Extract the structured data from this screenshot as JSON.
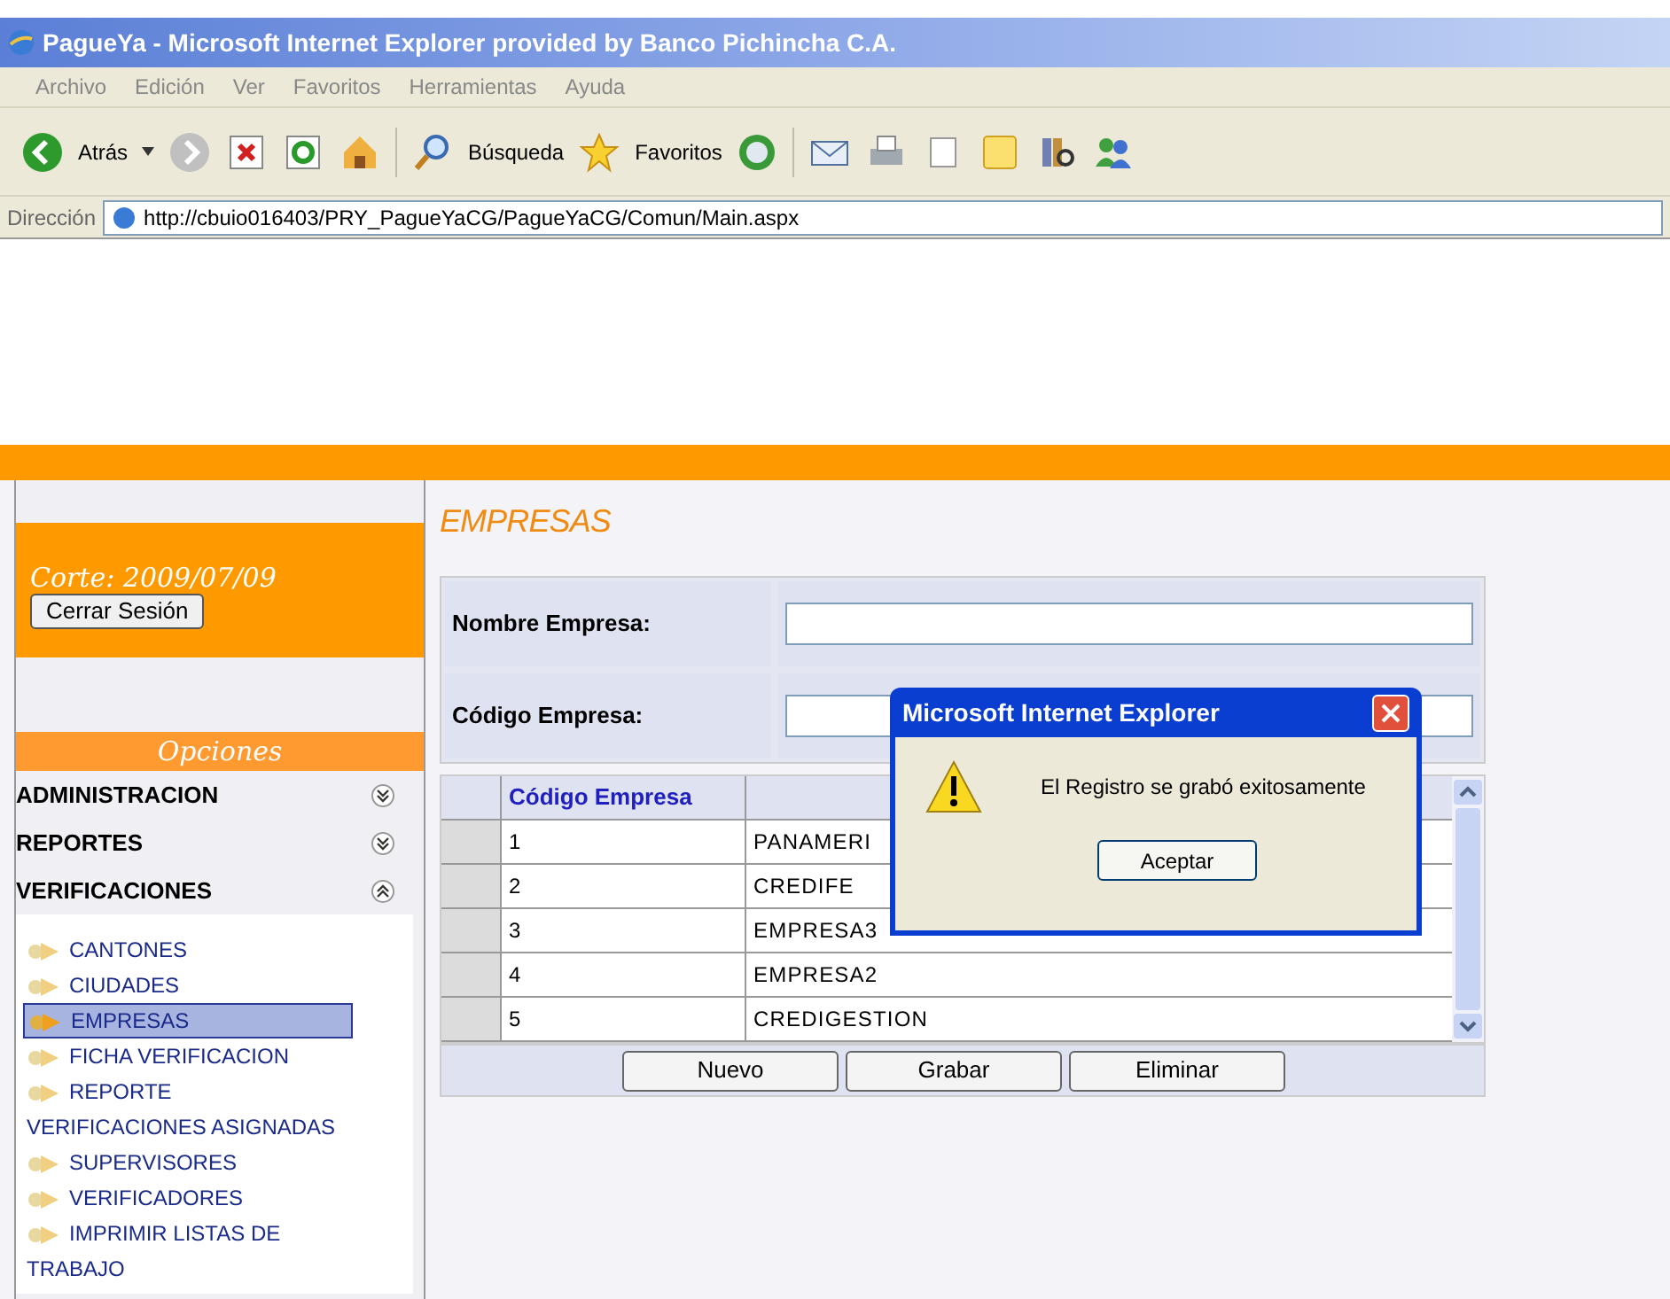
{
  "window": {
    "title": "PagueYa - Microsoft Internet Explorer provided by Banco Pichincha C.A."
  },
  "menu_bar": [
    "Archivo",
    "Edición",
    "Ver",
    "Favoritos",
    "Herramientas",
    "Ayuda"
  ],
  "toolbar": {
    "back": "Atrás",
    "search": "Búsqueda",
    "favorites": "Favoritos"
  },
  "address_bar": {
    "label": "Dirección",
    "url": "http://cbuio016403/PRY_PagueYaCG/PagueYaCG/Comun/Main.aspx"
  },
  "sidebar": {
    "cutoff": "Corte: 2009/07/09",
    "logout": "Cerrar Sesión",
    "options_title": "Opciones",
    "sections": [
      {
        "label": "ADMINISTRACION",
        "expanded": false
      },
      {
        "label": "REPORTES",
        "expanded": false
      },
      {
        "label": "VERIFICACIONES",
        "expanded": true,
        "children": [
          {
            "label": "CANTONES",
            "selected": false
          },
          {
            "label": "CIUDADES",
            "selected": false
          },
          {
            "label": "EMPRESAS",
            "selected": true
          },
          {
            "label": "FICHA VERIFICACION",
            "selected": false
          },
          {
            "label": "REPORTE VERIFICACIONES ASIGNADAS",
            "selected": false
          },
          {
            "label": "SUPERVISORES",
            "selected": false
          },
          {
            "label": "VERIFICADORES",
            "selected": false
          },
          {
            "label": "IMPRIMIR LISTAS DE TRABAJO",
            "selected": false
          }
        ]
      }
    ]
  },
  "page": {
    "title": "EMPRESAS",
    "fields": [
      {
        "label": "Nombre Empresa:"
      },
      {
        "label": "Código Empresa:"
      }
    ],
    "grid": {
      "columns": [
        "Código Empresa"
      ],
      "rows": [
        {
          "code": "1",
          "name": "PANAMERI"
        },
        {
          "code": "2",
          "name": "CREDIFE"
        },
        {
          "code": "3",
          "name": "EMPRESA3"
        },
        {
          "code": "4",
          "name": "EMPRESA2"
        },
        {
          "code": "5",
          "name": "CREDIGESTION"
        }
      ]
    },
    "buttons": [
      "Nuevo",
      "Grabar",
      "Eliminar"
    ]
  },
  "dialog": {
    "title": "Microsoft Internet Explorer",
    "message": "El Registro se grabó exitosamente",
    "button": "Aceptar"
  }
}
